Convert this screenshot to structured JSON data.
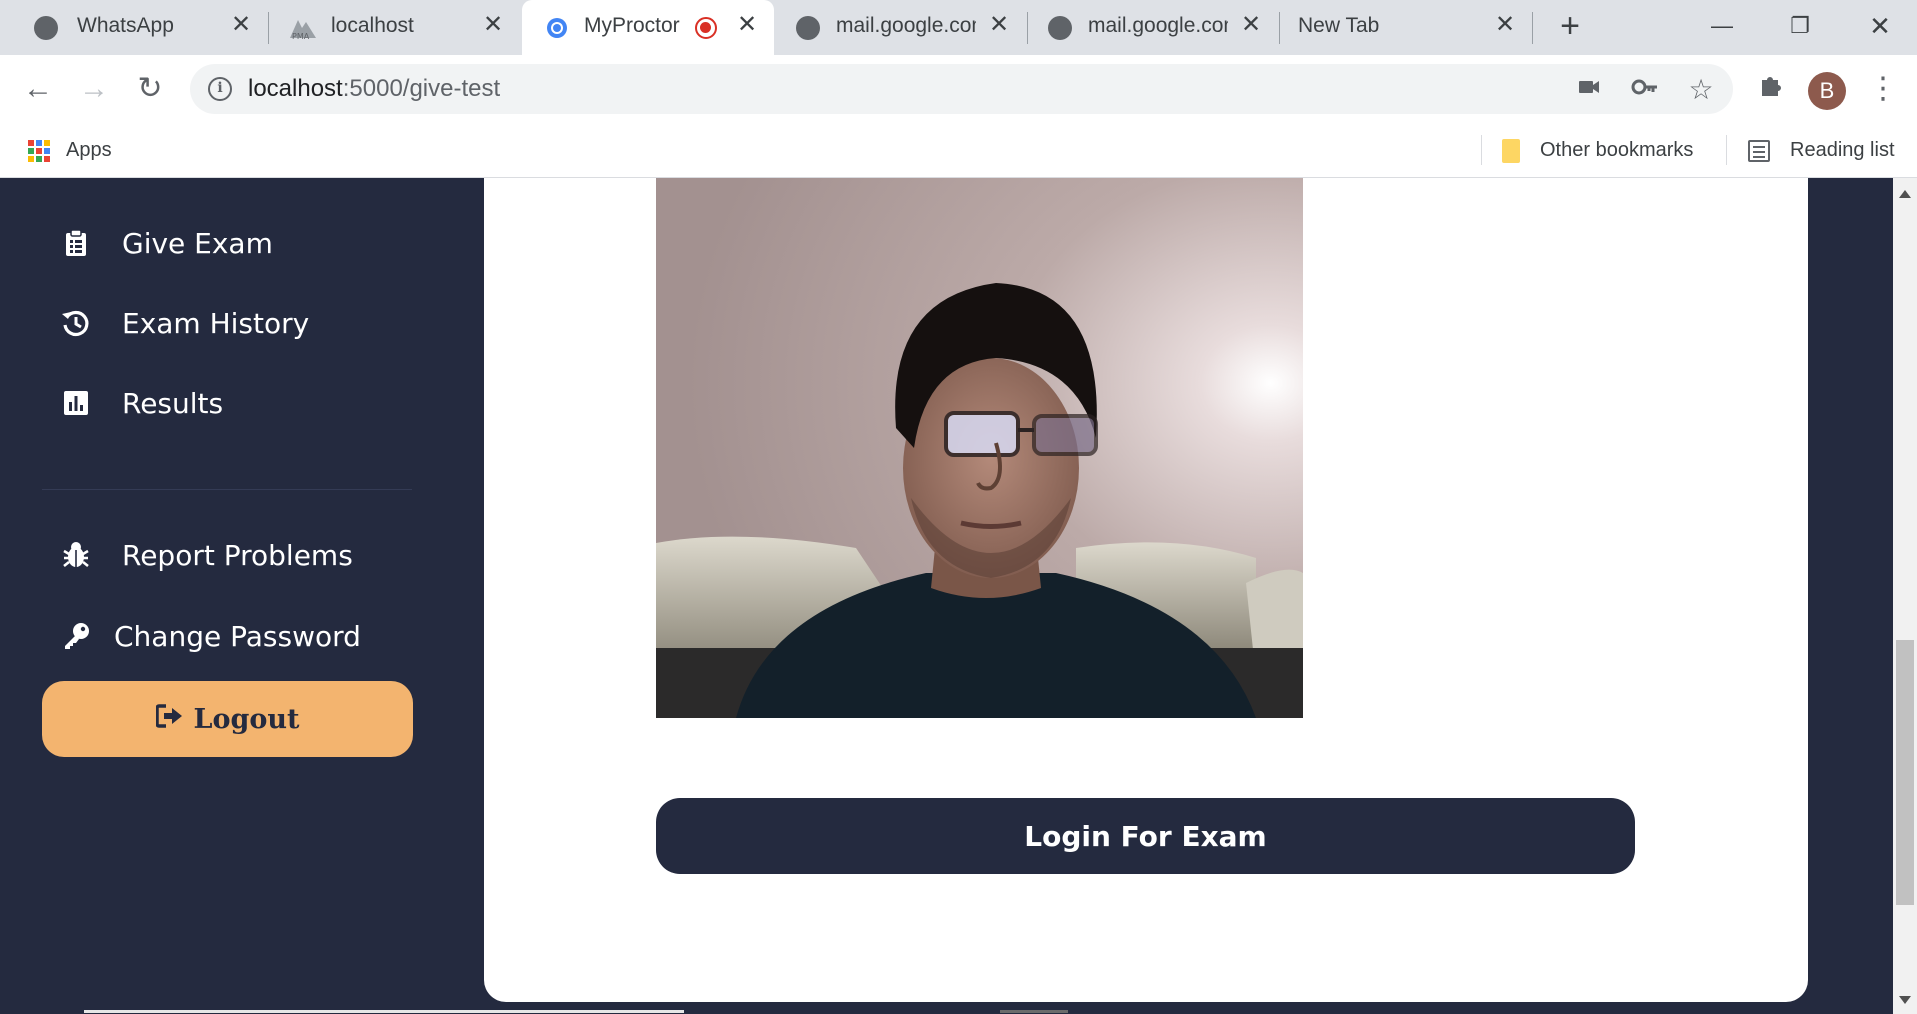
{
  "tabs": [
    {
      "title": "WhatsApp",
      "icon": "globe-icon"
    },
    {
      "title": "localhost",
      "icon": "phpmyadmin-icon"
    },
    {
      "title": "MyProctor",
      "icon": "chrome-dot-icon",
      "recording": true,
      "active": true
    },
    {
      "title": "mail.google.com",
      "icon": "globe-icon"
    },
    {
      "title": "mail.google.com",
      "icon": "globe-icon"
    },
    {
      "title": "New Tab",
      "icon": ""
    }
  ],
  "toolbar": {
    "url_host": "localhost",
    "url_path": ":5000/give-test",
    "profile_initial": "B"
  },
  "bookmarks": {
    "apps_label": "Apps",
    "other_bookmarks_label": "Other bookmarks",
    "reading_list_label": "Reading list"
  },
  "sidebar": {
    "items": [
      {
        "label": "Give Exam",
        "icon": "clipboard-icon"
      },
      {
        "label": "Exam History",
        "icon": "history-icon"
      },
      {
        "label": "Results",
        "icon": "bar-chart-icon"
      },
      {
        "label": "Report Problems",
        "icon": "bug-icon"
      },
      {
        "label": "Change Password",
        "icon": "key-icon"
      }
    ],
    "logout_label": "Logout"
  },
  "main": {
    "login_button_label": "Login For Exam"
  },
  "colors": {
    "sidebar_bg": "#242a3f",
    "logout_bg": "#f3b46f",
    "content_bg": "#ffffff",
    "recording_red": "#d93025"
  }
}
